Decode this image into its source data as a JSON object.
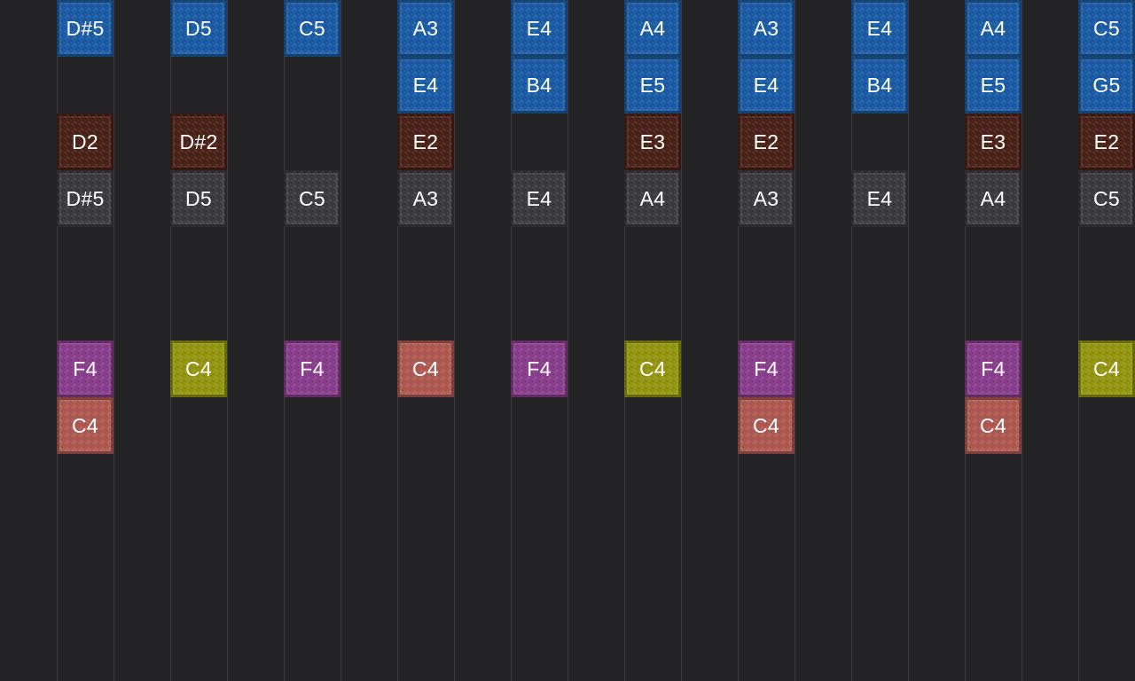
{
  "colors": {
    "background": "#242426",
    "blue": "#1b5da6",
    "maroon": "#4a2218",
    "gray": "#3c3c3e",
    "purple": "#8a3f8e",
    "olive": "#959712",
    "salmon": "#b05a52"
  },
  "notes": [
    {
      "col": 0,
      "row": 0,
      "label": "D#5",
      "color": "blue"
    },
    {
      "col": 0,
      "row": 2,
      "label": "D2",
      "color": "maroon"
    },
    {
      "col": 0,
      "row": 3,
      "label": "D#5",
      "color": "gray"
    },
    {
      "col": 0,
      "row": 6,
      "label": "F4",
      "color": "purple"
    },
    {
      "col": 0,
      "row": 7,
      "label": "C4",
      "color": "salmon"
    },
    {
      "col": 1,
      "row": 0,
      "label": "D5",
      "color": "blue"
    },
    {
      "col": 1,
      "row": 2,
      "label": "D#2",
      "color": "maroon"
    },
    {
      "col": 1,
      "row": 3,
      "label": "D5",
      "color": "gray"
    },
    {
      "col": 1,
      "row": 6,
      "label": "C4",
      "color": "olive"
    },
    {
      "col": 2,
      "row": 0,
      "label": "C5",
      "color": "blue"
    },
    {
      "col": 2,
      "row": 3,
      "label": "C5",
      "color": "gray"
    },
    {
      "col": 2,
      "row": 6,
      "label": "F4",
      "color": "purple"
    },
    {
      "col": 3,
      "row": 0,
      "label": "A3",
      "color": "blue"
    },
    {
      "col": 3,
      "row": 1,
      "label": "E4",
      "color": "blue"
    },
    {
      "col": 3,
      "row": 2,
      "label": "E2",
      "color": "maroon"
    },
    {
      "col": 3,
      "row": 3,
      "label": "A3",
      "color": "gray"
    },
    {
      "col": 3,
      "row": 6,
      "label": "C4",
      "color": "salmon"
    },
    {
      "col": 4,
      "row": 0,
      "label": "E4",
      "color": "blue"
    },
    {
      "col": 4,
      "row": 1,
      "label": "B4",
      "color": "blue"
    },
    {
      "col": 4,
      "row": 3,
      "label": "E4",
      "color": "gray"
    },
    {
      "col": 4,
      "row": 6,
      "label": "F4",
      "color": "purple"
    },
    {
      "col": 5,
      "row": 0,
      "label": "A4",
      "color": "blue"
    },
    {
      "col": 5,
      "row": 1,
      "label": "E5",
      "color": "blue"
    },
    {
      "col": 5,
      "row": 2,
      "label": "E3",
      "color": "maroon"
    },
    {
      "col": 5,
      "row": 3,
      "label": "A4",
      "color": "gray"
    },
    {
      "col": 5,
      "row": 6,
      "label": "C4",
      "color": "olive"
    },
    {
      "col": 6,
      "row": 0,
      "label": "A3",
      "color": "blue"
    },
    {
      "col": 6,
      "row": 1,
      "label": "E4",
      "color": "blue"
    },
    {
      "col": 6,
      "row": 2,
      "label": "E2",
      "color": "maroon"
    },
    {
      "col": 6,
      "row": 3,
      "label": "A3",
      "color": "gray"
    },
    {
      "col": 6,
      "row": 6,
      "label": "F4",
      "color": "purple"
    },
    {
      "col": 6,
      "row": 7,
      "label": "C4",
      "color": "salmon"
    },
    {
      "col": 7,
      "row": 0,
      "label": "E4",
      "color": "blue"
    },
    {
      "col": 7,
      "row": 1,
      "label": "B4",
      "color": "blue"
    },
    {
      "col": 7,
      "row": 3,
      "label": "E4",
      "color": "gray"
    },
    {
      "col": 8,
      "row": 0,
      "label": "A4",
      "color": "blue"
    },
    {
      "col": 8,
      "row": 1,
      "label": "E5",
      "color": "blue"
    },
    {
      "col": 8,
      "row": 2,
      "label": "E3",
      "color": "maroon"
    },
    {
      "col": 8,
      "row": 3,
      "label": "A4",
      "color": "gray"
    },
    {
      "col": 8,
      "row": 6,
      "label": "F4",
      "color": "purple"
    },
    {
      "col": 8,
      "row": 7,
      "label": "C4",
      "color": "salmon"
    },
    {
      "col": 9,
      "row": 0,
      "label": "C5",
      "color": "blue"
    },
    {
      "col": 9,
      "row": 1,
      "label": "G5",
      "color": "blue"
    },
    {
      "col": 9,
      "row": 2,
      "label": "E2",
      "color": "maroon"
    },
    {
      "col": 9,
      "row": 3,
      "label": "C5",
      "color": "gray"
    },
    {
      "col": 9,
      "row": 6,
      "label": "C4",
      "color": "olive"
    }
  ]
}
